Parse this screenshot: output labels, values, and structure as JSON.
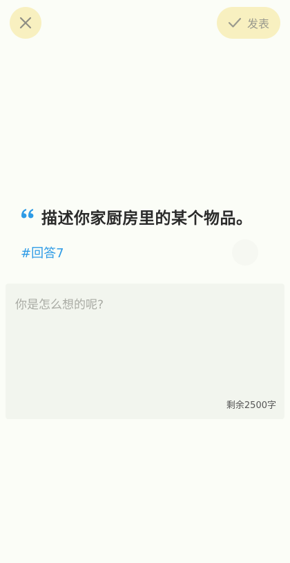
{
  "header": {
    "close_icon": "close-icon",
    "publish_icon": "check-icon",
    "publish_label": "发表"
  },
  "question": {
    "quote_icon": "quote-icon",
    "text": "描述你家厨房里的某个物品。",
    "tag": "#回答7"
  },
  "editor": {
    "placeholder": "你是怎么想的呢?",
    "value": "",
    "remaining_label": "剩余2500字"
  },
  "colors": {
    "background": "#fbfdf7",
    "button_bg": "#f8f0c0",
    "accent": "#2e9be6",
    "editor_bg": "#f2f5ee"
  }
}
